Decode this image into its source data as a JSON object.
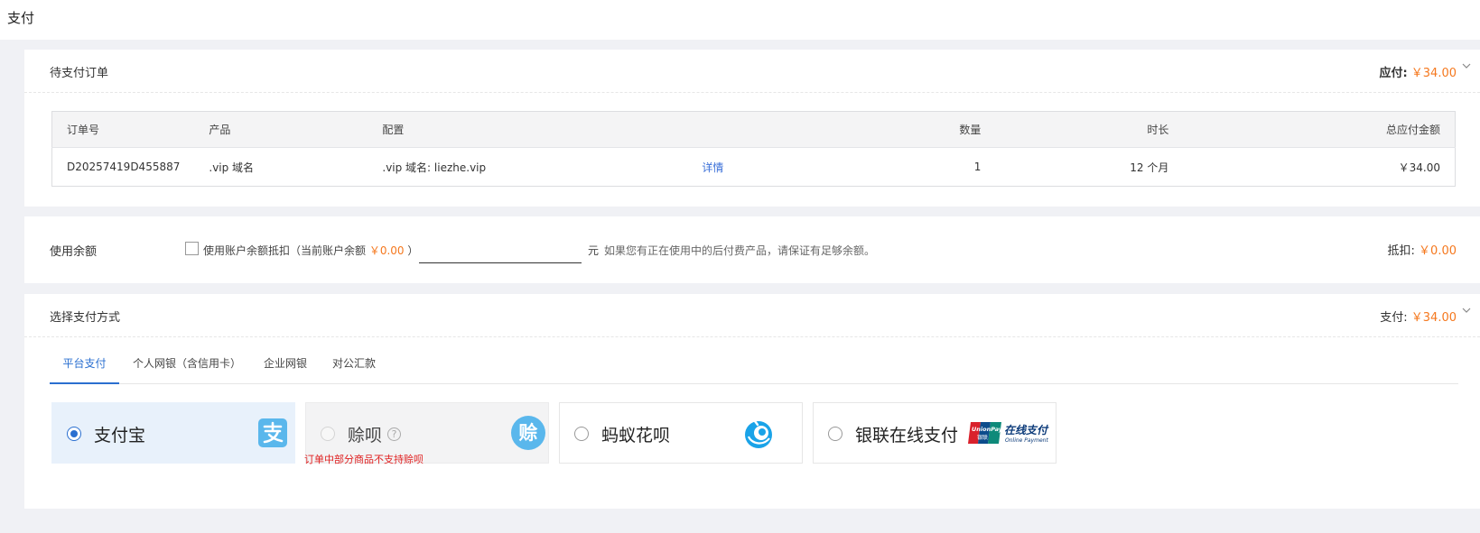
{
  "page": {
    "title": "支付"
  },
  "order_card": {
    "title": "待支付订单",
    "due_label": "应付:",
    "due_amount": "￥34.00",
    "columns": [
      "订单号",
      "产品",
      "配置",
      "数量",
      "时长",
      "总应付金额"
    ],
    "rows": [
      {
        "order_no": "D20257419D455887",
        "product": ".vip 域名",
        "config": ".vip 域名: liezhe.vip",
        "detail_link": "详情",
        "quantity": "1",
        "duration": "12 个月",
        "total": "￥34.00"
      }
    ]
  },
  "balance_card": {
    "title": "使用余额",
    "checkbox_label": "使用账户余额抵扣（当前账户余额",
    "balance_value": "￥0.00",
    "checkbox_label_close": "）",
    "input_value": "",
    "unit": "元",
    "note": "如果您有正在使用中的后付费产品，请保证有足够余额。",
    "deduct_label": "抵扣:",
    "deduct_amount": "￥0.00"
  },
  "payment_card": {
    "title": "选择支付方式",
    "pay_label": "支付:",
    "pay_amount": "￥34.00",
    "tabs": [
      "平台支付",
      "个人网银（含信用卡）",
      "企业网银",
      "对公汇款"
    ],
    "active_tab": 0,
    "methods": [
      {
        "label": "支付宝",
        "icon": "alipay-icon",
        "state": "selected"
      },
      {
        "label": "赊呗",
        "icon": "shebei-icon",
        "state": "disabled"
      },
      {
        "label": "蚂蚁花呗",
        "icon": "huabei-icon",
        "state": "normal"
      },
      {
        "label": "银联在线支付",
        "icon": "unionpay-icon",
        "state": "normal"
      }
    ],
    "unionpay_logo_text": {
      "brand": "UnionPay",
      "brand_cn": "银联",
      "cn": "在线支付",
      "en": "Online Payment"
    },
    "shebei_logo_text": "赊",
    "warning": "订单中部分商品不支持赊呗"
  },
  "colors": {
    "accent": "#2a6fd0",
    "amount": "#f5781e",
    "alipay": "#5ab7ec",
    "warning": "#e02020"
  }
}
